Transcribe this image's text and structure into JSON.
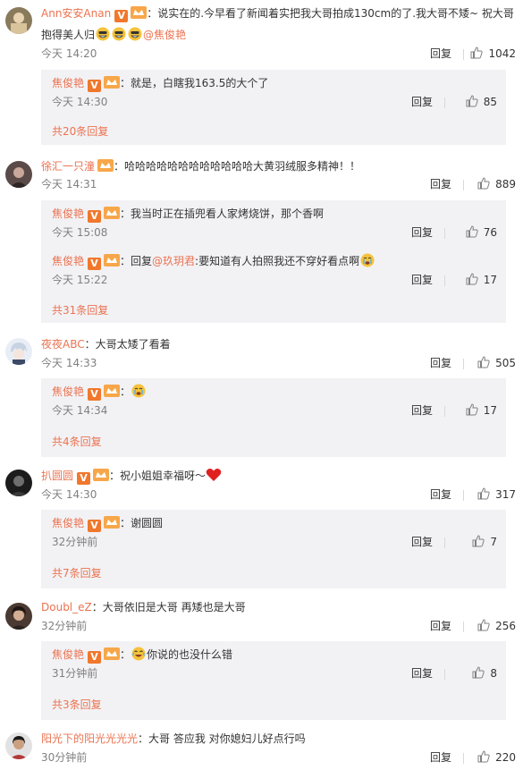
{
  "reply_label": "回复",
  "comments": [
    {
      "user": "Ann安安Anan",
      "line1": "：说实在的.今早看了新闻着实把我大哥拍成130cm的了.我大哥不矮~ 祝大哥",
      "line2": "抱得美人归",
      "mention": "@焦俊艳",
      "time": "今天 14:20",
      "likes": "1042",
      "replies": [
        {
          "user": "焦俊艳",
          "text": "：就是，白瞎我163.5的大个了",
          "time": "今天 14:30",
          "likes": "85"
        }
      ],
      "more": "共20条回复"
    },
    {
      "user": "徐汇一只潼",
      "text": "：哈哈哈哈哈哈哈哈哈哈哈哈大黄羽绒服多精神！！",
      "time": "今天 14:31",
      "likes": "889",
      "replies": [
        {
          "user": "焦俊艳",
          "text": "：我当时正在插兜看人家烤烧饼，那个香啊",
          "time": "今天 15:08",
          "likes": "76"
        },
        {
          "user": "焦俊艳",
          "prefix": "：回复",
          "mention": "@玖玥君",
          "text": ":要知道有人拍照我还不穿好看点啊",
          "time": "今天 15:22",
          "likes": "17"
        }
      ],
      "more": "共31条回复"
    },
    {
      "user": "夜夜ABC",
      "text": "：大哥太矮了看着",
      "time": "今天 14:33",
      "likes": "505",
      "replies": [
        {
          "user": "焦俊艳",
          "text": "：",
          "time": "今天 14:34",
          "likes": "17"
        }
      ],
      "more": "共4条回复"
    },
    {
      "user": "扒圆圆",
      "text": "：祝小姐姐幸福呀～",
      "time": "今天 14:30",
      "likes": "317",
      "replies": [
        {
          "user": "焦俊艳",
          "text": "：谢圆圆",
          "time": "32分钟前",
          "likes": "7"
        }
      ],
      "more": "共7条回复"
    },
    {
      "user": "Doubl_eZ",
      "text": "：大哥依旧是大哥 再矮也是大哥",
      "time": "32分钟前",
      "likes": "256",
      "replies": [
        {
          "user": "焦俊艳",
          "text": "你说的也没什么错",
          "time": "31分钟前",
          "likes": "8"
        }
      ],
      "more": "共3条回复"
    },
    {
      "user": "阳光下的阳光光光光",
      "text": "：大哥 答应我 对你媳妇儿好点行吗",
      "time": "30分钟前",
      "likes": "220"
    }
  ],
  "colors": {
    "username": "#eb7350",
    "reply_bg": "#f2f2f5",
    "verified": "#f0782d"
  },
  "icons": [
    "verified-v-icon",
    "vip-crown-icon",
    "thumbs-up-icon",
    "grin-emoji-icon",
    "crying-emoji-icon",
    "laughing-emoji-icon",
    "heart-icon"
  ]
}
